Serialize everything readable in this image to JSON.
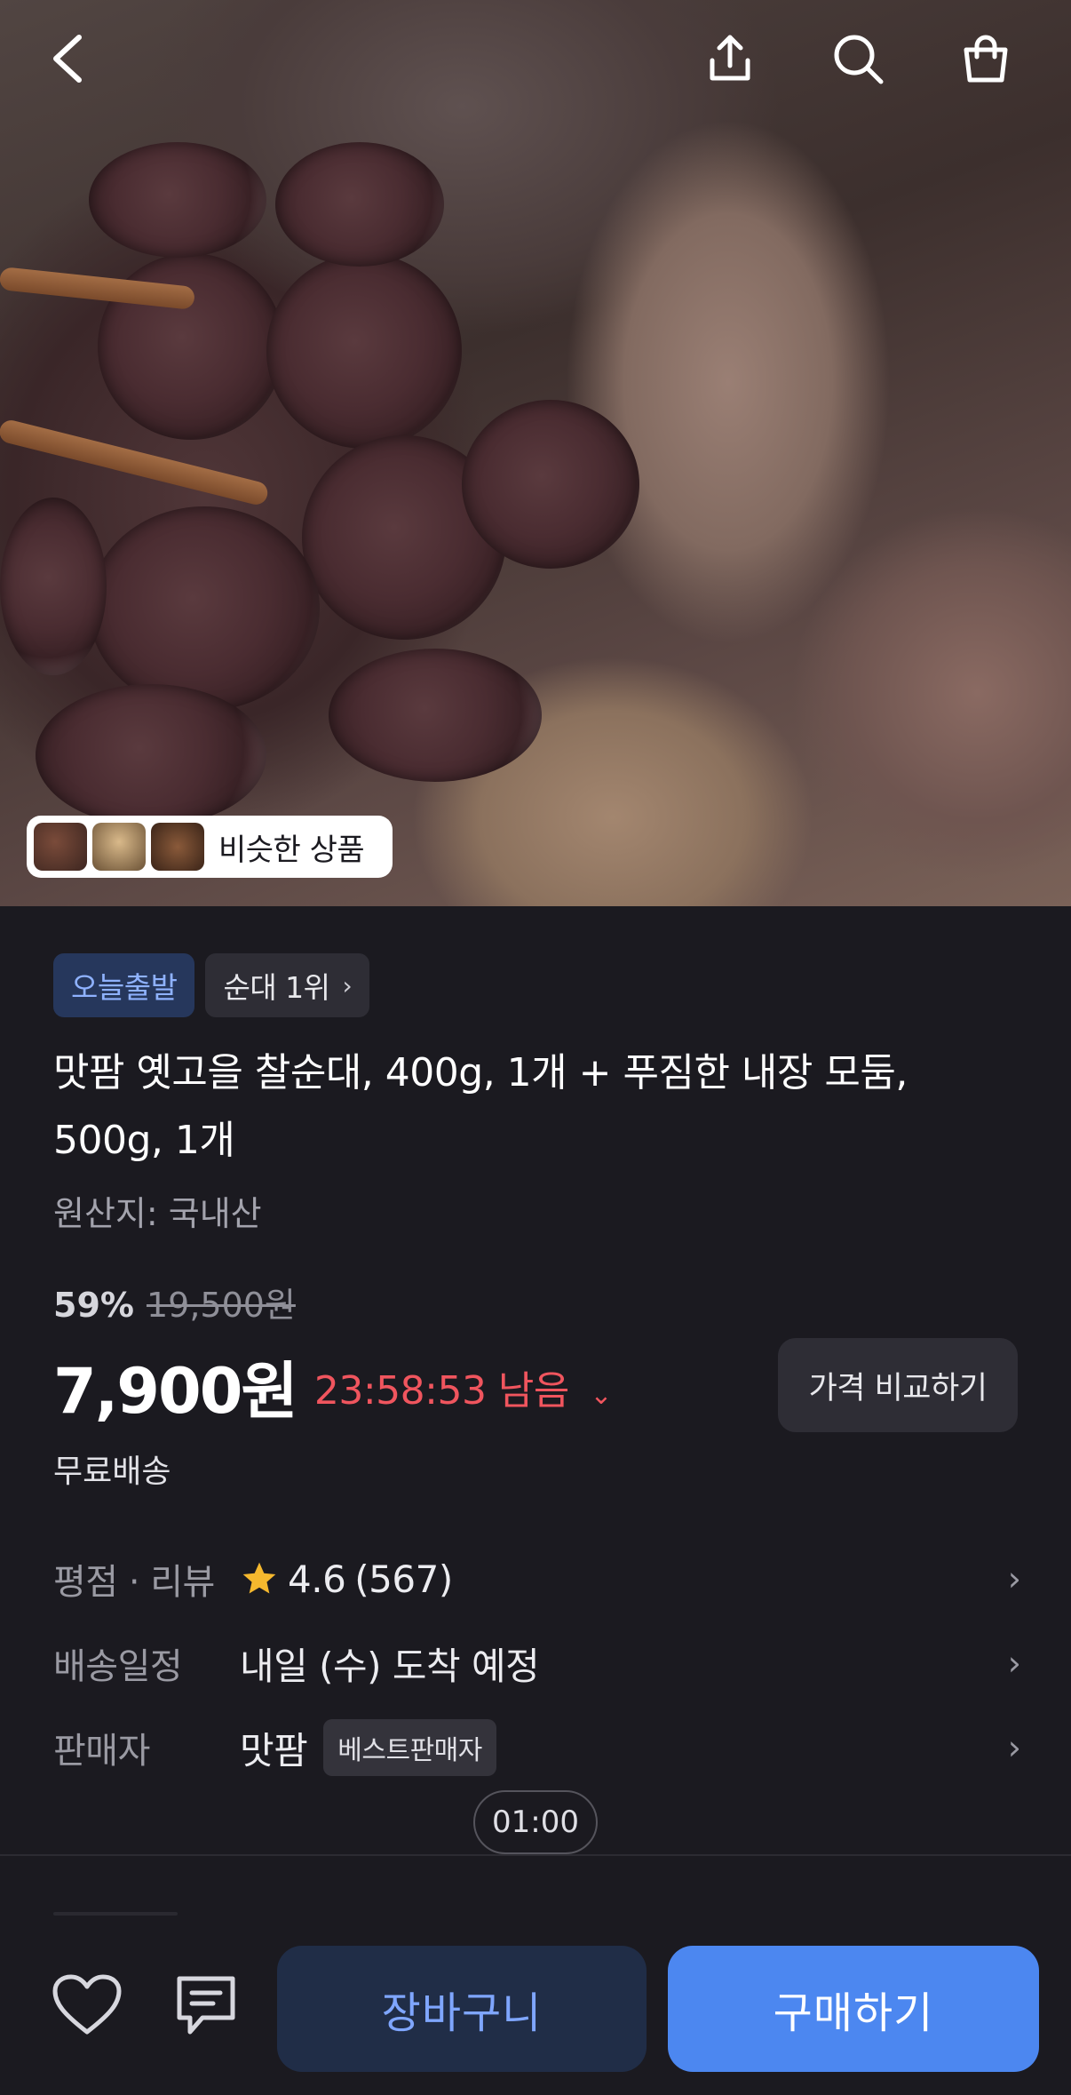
{
  "hero": {
    "similar_label": "비슷한 상품"
  },
  "product": {
    "badges": {
      "today_delivery": "오늘출발",
      "rank": "순대 1위"
    },
    "title": "맛팜 옛고을 찰순대, 400g, 1개 + 푸짐한 내장 모둠, 500g, 1개",
    "origin": "원산지: 국내산",
    "discount_percent": "59%",
    "original_price": "19,500원",
    "price": "7,900원",
    "timer": "23:58:53 남음",
    "compare_button": "가격 비교하기",
    "shipping": "무료배송"
  },
  "info": {
    "rating": {
      "key": "평점 · 리뷰",
      "score": "4.6",
      "count": "(567)"
    },
    "delivery": {
      "key": "배송일정",
      "value": "내일 (수) 도착 예정"
    },
    "seller": {
      "key": "판매자",
      "value": "맛팜",
      "badge": "베스트판매자"
    }
  },
  "time_pill": "01:00",
  "actions": {
    "cart": "장바구니",
    "buy": "구매하기"
  },
  "colors": {
    "background": "#1b1a20",
    "timer": "#f0555e",
    "buy_button": "#4c87f0",
    "cart_button": "#202d47",
    "star": "#f5b82e"
  }
}
